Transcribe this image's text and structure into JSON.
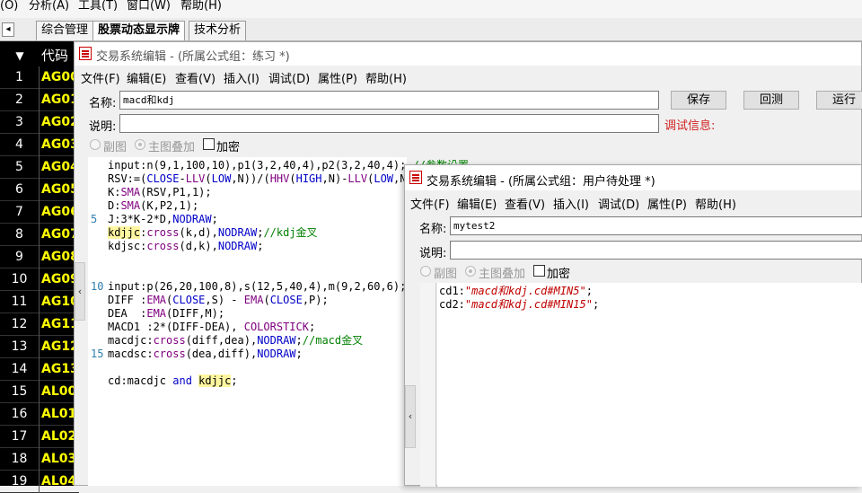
{
  "topmenu": [
    "(O)",
    "分析(A)",
    "工具(T)",
    "窗口(W)",
    "帮助(H)"
  ],
  "tabs": [
    "综合管理",
    "股票动态显示牌",
    "技术分析"
  ],
  "stocklist": {
    "header": "代码",
    "rows": [
      {
        "num": "1",
        "code": "AG00"
      },
      {
        "num": "2",
        "code": "AG01"
      },
      {
        "num": "3",
        "code": "AG02"
      },
      {
        "num": "4",
        "code": "AG03"
      },
      {
        "num": "5",
        "code": "AG04"
      },
      {
        "num": "6",
        "code": "AG05"
      },
      {
        "num": "7",
        "code": "AG06"
      },
      {
        "num": "8",
        "code": "AG07"
      },
      {
        "num": "9",
        "code": "AG08"
      },
      {
        "num": "10",
        "code": "AG09"
      },
      {
        "num": "11",
        "code": "AG10"
      },
      {
        "num": "12",
        "code": "AG11"
      },
      {
        "num": "13",
        "code": "AG12"
      },
      {
        "num": "14",
        "code": "AG13"
      },
      {
        "num": "15",
        "code": "AL00"
      },
      {
        "num": "16",
        "code": "AL01"
      },
      {
        "num": "17",
        "code": "AL02"
      },
      {
        "num": "18",
        "code": "AL03"
      },
      {
        "num": "19",
        "code": "AL04"
      }
    ]
  },
  "editor1": {
    "title": "交易系统编辑 - (所属公式组：练习 *)",
    "menu": [
      "文件(F)",
      "编辑(E)",
      "查看(V)",
      "插入(I)",
      "调试(D)",
      "属性(P)",
      "帮助(H)"
    ],
    "name_label": "名称:",
    "name_value": "macd和kdj",
    "desc_label": "说明:",
    "desc_value": "",
    "save": "保存",
    "backtest": "回测",
    "run": "运行",
    "debug_label": "调试信息:",
    "sub_chart": "副图",
    "main_overlay": "主图叠加",
    "encrypt": "加密",
    "line_numbers": [
      "5",
      "10",
      "15"
    ]
  },
  "editor2": {
    "title": "交易系统编辑 - (所属公式组：用户待处理 *)",
    "menu": [
      "文件(F)",
      "编辑(E)",
      "查看(V)",
      "插入(I)",
      "调试(D)",
      "属性(P)",
      "帮助(H)"
    ],
    "name_label": "名称:",
    "name_value": "mytest2",
    "desc_label": "说明:",
    "desc_value": "",
    "sub_chart": "副图",
    "main_overlay": "主图叠加",
    "encrypt": "加密"
  },
  "colors": {
    "code_yellow": "#ffff00",
    "keyword": "#0000c8",
    "function": "#800080",
    "comment": "#008000",
    "string": "#c00000"
  }
}
